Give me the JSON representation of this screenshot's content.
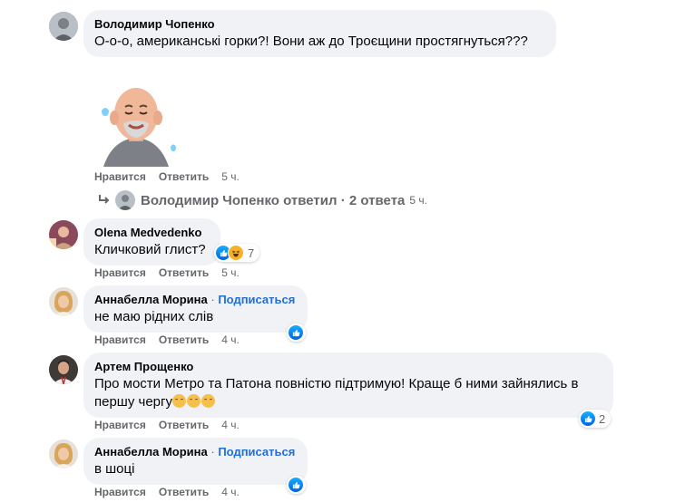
{
  "comments": [
    {
      "author": "Володимир Чопенко",
      "text": "О-о-о, американські горки?! Вони аж до Троєщини простягнуться???"
    },
    {
      "sticker": "bald-man-sweating-sticker",
      "actions": {
        "like": "Нравится",
        "reply": "Ответить",
        "time": "5 ч."
      },
      "replies": {
        "author": "Володимир Чопенко",
        "label": "ответил",
        "sep": "·",
        "count": "2 ответа",
        "time": "5 ч."
      }
    },
    {
      "author": "Olena Medvedenko",
      "text": "Кличковий глист?",
      "reactions": {
        "icons": [
          "like-icon",
          "haha-icon"
        ],
        "count": "7"
      },
      "actions": {
        "like": "Нравится",
        "reply": "Ответить",
        "time": "5 ч."
      }
    },
    {
      "author": "Аннабелла Морина",
      "sep": "·",
      "subscribe": "Подписаться",
      "text": "не маю рідних слів",
      "reactions": {
        "icons": [
          "like-icon"
        ],
        "count": ""
      },
      "actions": {
        "like": "Нравится",
        "reply": "Ответить",
        "time": "4 ч."
      }
    },
    {
      "author": "Артем Прощенко",
      "text_line1": "Про мости Метро та Патона повністю підтримую! Краще б ними зайнялись в",
      "text_line2": "першу чергу",
      "emojis": [
        "relieved-face-emoji",
        "relieved-face-emoji",
        "relieved-face-emoji"
      ],
      "reactions": {
        "icons": [
          "like-icon"
        ],
        "count": "2"
      },
      "actions": {
        "like": "Нравится",
        "reply": "Ответить",
        "time": "4 ч."
      }
    },
    {
      "author": "Аннабелла Морина",
      "sep": "·",
      "subscribe": "Подписаться",
      "text": "в шоці",
      "reactions": {
        "icons": [
          "like-icon"
        ],
        "count": ""
      },
      "actions": {
        "like": "Нравится",
        "reply": "Ответить",
        "time": "4 ч."
      }
    }
  ],
  "colors": {
    "bubble": "#f0f2f5",
    "link": "#216fdb",
    "meta": "#65676b",
    "like": "#1877f2"
  }
}
